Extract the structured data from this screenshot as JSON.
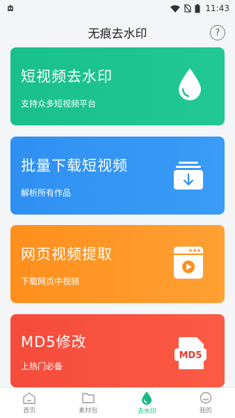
{
  "status_bar": {
    "time": "11:43"
  },
  "header": {
    "title": "无痕去水印",
    "help_label": "?"
  },
  "cards": [
    {
      "title": "短视频去水印",
      "subtitle": "支持众多短视频平台",
      "icon": "water-drop-icon",
      "color": "#19c08b"
    },
    {
      "title": "批量下载短视频",
      "subtitle": "解析所有作品",
      "icon": "download-stack-icon",
      "color": "#2f90f2"
    },
    {
      "title": "网页视频提取",
      "subtitle": "下载网页中视频",
      "icon": "browser-video-icon",
      "color": "#ff8f1c"
    },
    {
      "title": "MD5修改",
      "subtitle": "上热门必备",
      "icon": "md5-file-icon",
      "icon_text": "MD5",
      "color": "#f64b3c"
    }
  ],
  "bottom_nav": [
    {
      "label": "首页",
      "icon": "home-icon"
    },
    {
      "label": "素材包",
      "icon": "folder-icon"
    },
    {
      "label": "去水印",
      "icon": "drop-icon",
      "active": true
    },
    {
      "label": "我的",
      "icon": "profile-icon"
    }
  ],
  "colors": {
    "accent": "#18b987",
    "background": "#f4f5f7"
  }
}
